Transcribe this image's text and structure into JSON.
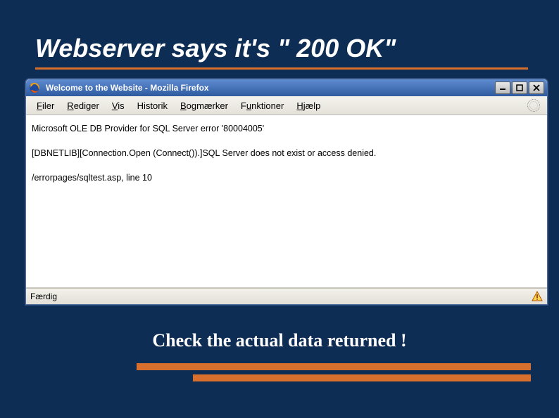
{
  "slide": {
    "title": "Webserver says it's \" 200 OK\"",
    "caption": "Check the actual data returned !"
  },
  "window": {
    "title": "Welcome to the Website - Mozilla Firefox"
  },
  "menu": {
    "filer": "Filer",
    "rediger": "Rediger",
    "vis": "Vis",
    "historik": "Historik",
    "bogmaerker": "Bogmærker",
    "funktioner": "Funktioner",
    "hjaelp": "Hjælp"
  },
  "page": {
    "line1": "Microsoft OLE DB Provider for SQL Server error '80004005'",
    "line2": "[DBNETLIB][Connection.Open (Connect()).]SQL Server does not exist or access denied.",
    "line3": "/errorpages/sqltest.asp, line 10"
  },
  "status": {
    "text": "Færdig"
  }
}
